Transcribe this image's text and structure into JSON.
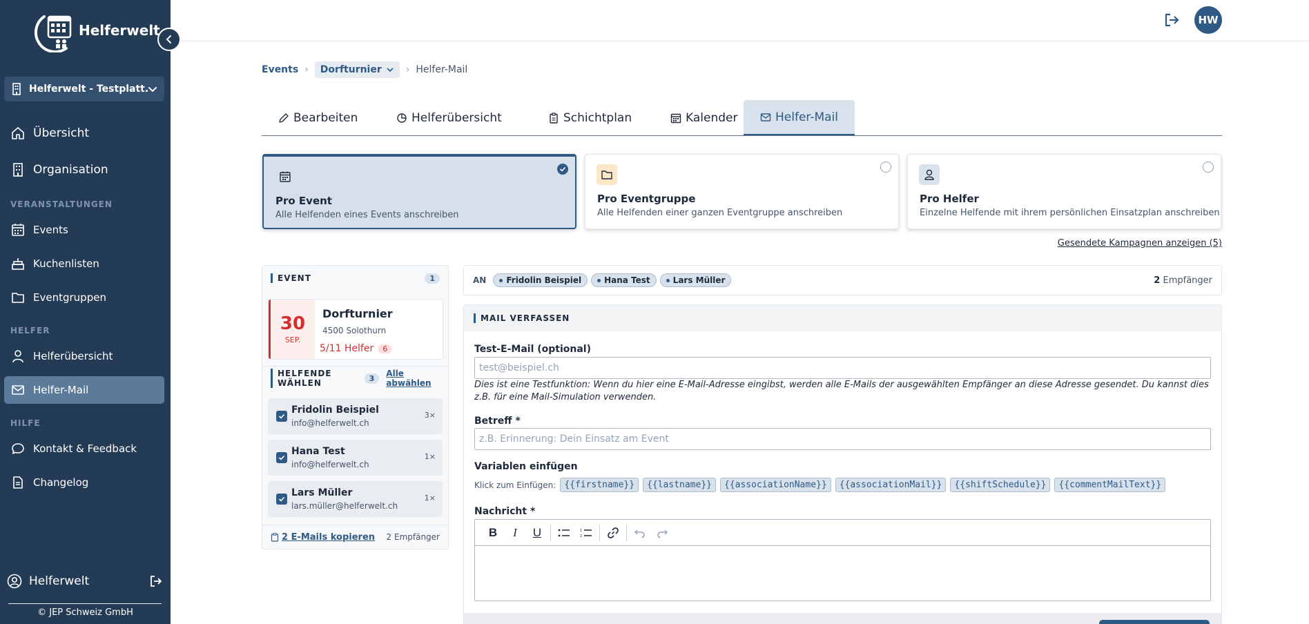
{
  "app": {
    "name": "Helferwelt",
    "org": "Helferwelt - Testplatt...",
    "copyright": "© JEP Schweiz GmbH",
    "user": "Helferwelt",
    "avatar": "HW"
  },
  "nav": {
    "overview": "Übersicht",
    "organisation": "Organisation",
    "section_events": "VERANSTALTUNGEN",
    "events": "Events",
    "cakes": "Kuchenlisten",
    "eventgroups": "Eventgruppen",
    "section_helpers": "HELFER",
    "helper_overview": "Helferübersicht",
    "helper_mail": "Helfer-Mail",
    "section_help": "HILFE",
    "contact": "Kontakt & Feedback",
    "changelog": "Changelog"
  },
  "breadcrumb": {
    "root": "Events",
    "event": "Dorfturnier",
    "current": "Helfer-Mail"
  },
  "tabs": [
    "Bearbeiten",
    "Helferübersicht",
    "Schichtplan",
    "Kalender",
    "Helfer-Mail"
  ],
  "modes": [
    {
      "title": "Pro Event",
      "desc": "Alle Helfenden eines Events anschreiben",
      "icon": "calendar-icon"
    },
    {
      "title": "Pro Eventgruppe",
      "desc": "Alle Helfenden einer ganzen Eventgruppe anschreiben",
      "icon": "folder-icon"
    },
    {
      "title": "Pro Helfer",
      "desc": "Einzelne Helfende mit ihrem persönlichen Einsatzplan anschreiben",
      "icon": "person-icon"
    }
  ],
  "sent_campaigns": "Gesendete Kampagnen anzeigen (5)",
  "event_panel": {
    "label": "EVENT",
    "count": "1",
    "event": {
      "day": "30",
      "month": "SEP.",
      "name": "Dorfturnier",
      "location": "4500 Solothurn",
      "helpers": "5/11 Helfer",
      "badge": "6"
    },
    "helpers_label": "HELFENDE WÄHLEN",
    "helpers_count": "3",
    "select_all": "Alle abwählen",
    "helpers": [
      {
        "name": "Fridolin Beispiel",
        "email": "info@helferwelt.ch",
        "count": "3×"
      },
      {
        "name": "Hana Test",
        "email": "info@helferwelt.ch",
        "count": "1×"
      },
      {
        "name": "Lars Müller",
        "email": "lars.müller@helferwelt.ch",
        "count": "1×"
      }
    ],
    "copy_emails": "2 E-Mails kopieren",
    "recipients": "2 Empfänger"
  },
  "to_bar": {
    "label": "AN",
    "chips": [
      "Fridolin Beispiel",
      "Hana Test",
      "Lars Müller"
    ],
    "count": "2",
    "count_suffix": "Empfänger"
  },
  "compose": {
    "header": "MAIL VERFASSEN",
    "test_label": "Test-E-Mail (optional)",
    "test_placeholder": "test@beispiel.ch",
    "hint": "Dies ist eine Testfunktion: Wenn du hier eine E-Mail-Adresse eingibst, werden alle E-Mails der ausgewählten Empfänger an diese Adresse gesendet. Du kannst dies z.B. für eine Mail-Simulation verwenden.",
    "subject_label": "Betreff *",
    "subject_placeholder": "z.B. Erinnerung: Dein Einsatz am Event",
    "vars_label": "Variablen einfügen",
    "vars_prefix": "Klick zum Einfügen:",
    "vars": [
      "{{firstname}}",
      "{{lastname}}",
      "{{associationName}}",
      "{{associationMail}}",
      "{{shiftSchedule}}",
      "{{commentMailText}}"
    ],
    "message_label": "Nachricht *"
  },
  "colors": {
    "sidebar": "#243b55",
    "accent": "#2f5a86",
    "danger": "#d32f2f"
  }
}
